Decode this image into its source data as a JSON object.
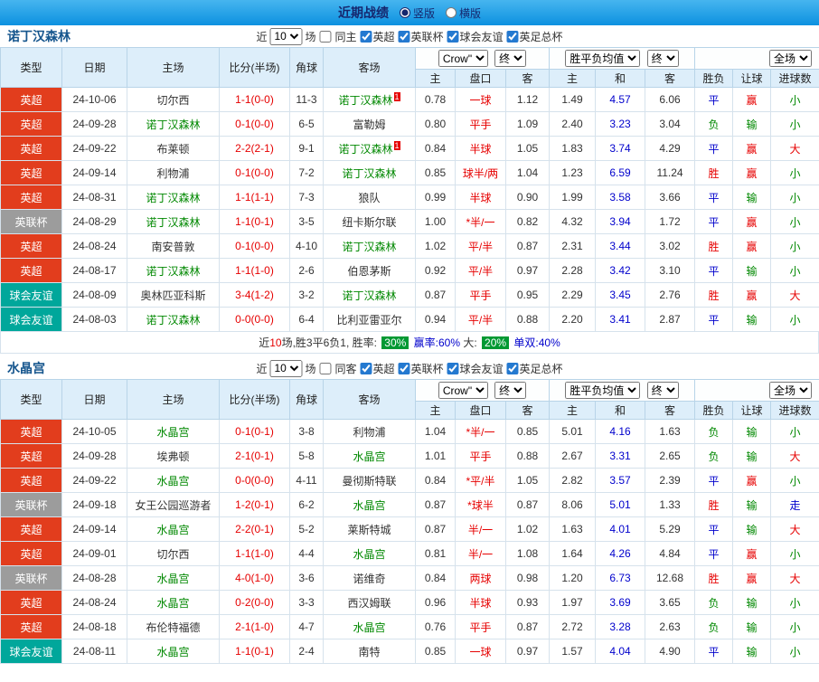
{
  "topbar": {
    "title": "近期战绩",
    "radios": [
      {
        "label": "竖版",
        "checked": true
      },
      {
        "label": "横版",
        "checked": false
      }
    ]
  },
  "colors": {
    "topbar_blue": "#0d91e0",
    "epl_red": "#e23d1d",
    "league_cup_gray": "#9c9c9c",
    "friendly_teal": "#00a79b",
    "focus_team_green": "#008800",
    "win_red": "#e60000",
    "loss_green": "#008800",
    "draw_blue": "#0000cc",
    "badge_green": "#009933"
  },
  "sections": [
    {
      "team": "诺丁汉森林",
      "filter": {
        "near": "近",
        "count": "10",
        "games": "场",
        "same": "同主",
        "same_checked": false,
        "leagues": [
          {
            "label": "英超",
            "checked": true
          },
          {
            "label": "英联杯",
            "checked": true
          },
          {
            "label": "球会友谊",
            "checked": true
          },
          {
            "label": "英足总杯",
            "checked": true
          }
        ]
      },
      "thead": {
        "type": "类型",
        "date": "日期",
        "home": "主场",
        "score": "比分(半场)",
        "corner": "角球",
        "away": "客场",
        "company": "Crow\"",
        "final1": "终",
        "avg": "胜平负均值",
        "final2": "终",
        "scope": "全场",
        "subs": [
          "主",
          "盘口",
          "客",
          "主",
          "和",
          "客",
          "胜负",
          "让球",
          "进球数"
        ]
      },
      "rows": [
        {
          "l": "英超",
          "lc": "lg-epl",
          "d": "24-10-06",
          "h": "切尔西",
          "hf": false,
          "hs": "",
          "s": "1-1(0-0)",
          "c": "11-3",
          "a": "诺丁汉森林",
          "af": true,
          "as": "1",
          "o1": "0.78",
          "hc": "一球",
          "o2": "1.12",
          "e1": "1.49",
          "e2": "4.57",
          "e3": "6.06",
          "r": "平",
          "rc": "t-blue",
          "lt": "赢",
          "ltc": "t-red",
          "g": "小",
          "gc": "t-green"
        },
        {
          "l": "英超",
          "lc": "lg-epl",
          "d": "24-09-28",
          "h": "诺丁汉森林",
          "hf": true,
          "hs": "",
          "s": "0-1(0-0)",
          "c": "6-5",
          "a": "富勒姆",
          "af": false,
          "as": "",
          "o1": "0.80",
          "hc": "平手",
          "o2": "1.09",
          "e1": "2.40",
          "e2": "3.23",
          "e3": "3.04",
          "r": "负",
          "rc": "t-green",
          "lt": "输",
          "ltc": "t-green",
          "g": "小",
          "gc": "t-green"
        },
        {
          "l": "英超",
          "lc": "lg-epl",
          "d": "24-09-22",
          "h": "布莱顿",
          "hf": false,
          "hs": "",
          "s": "2-2(2-1)",
          "c": "9-1",
          "a": "诺丁汉森林",
          "af": true,
          "as": "1",
          "o1": "0.84",
          "hc": "半球",
          "o2": "1.05",
          "e1": "1.83",
          "e2": "3.74",
          "e3": "4.29",
          "r": "平",
          "rc": "t-blue",
          "lt": "赢",
          "ltc": "t-red",
          "g": "大",
          "gc": "t-red"
        },
        {
          "l": "英超",
          "lc": "lg-epl",
          "d": "24-09-14",
          "h": "利物浦",
          "hf": false,
          "hs": "",
          "s": "0-1(0-0)",
          "c": "7-2",
          "a": "诺丁汉森林",
          "af": true,
          "as": "",
          "o1": "0.85",
          "hc": "球半/两",
          "o2": "1.04",
          "e1": "1.23",
          "e2": "6.59",
          "e3": "11.24",
          "r": "胜",
          "rc": "t-red",
          "lt": "赢",
          "ltc": "t-red",
          "g": "小",
          "gc": "t-green"
        },
        {
          "l": "英超",
          "lc": "lg-epl",
          "d": "24-08-31",
          "h": "诺丁汉森林",
          "hf": true,
          "hs": "",
          "s": "1-1(1-1)",
          "c": "7-3",
          "a": "狼队",
          "af": false,
          "as": "",
          "o1": "0.99",
          "hc": "半球",
          "o2": "0.90",
          "e1": "1.99",
          "e2": "3.58",
          "e3": "3.66",
          "r": "平",
          "rc": "t-blue",
          "lt": "输",
          "ltc": "t-green",
          "g": "小",
          "gc": "t-green"
        },
        {
          "l": "英联杯",
          "lc": "lg-lc",
          "d": "24-08-29",
          "h": "诺丁汉森林",
          "hf": true,
          "hs": "",
          "s": "1-1(0-1)",
          "c": "3-5",
          "a": "纽卡斯尔联",
          "af": false,
          "as": "",
          "o1": "1.00",
          "hc": "*半/一",
          "o2": "0.82",
          "e1": "4.32",
          "e2": "3.94",
          "e3": "1.72",
          "r": "平",
          "rc": "t-blue",
          "lt": "赢",
          "ltc": "t-red",
          "g": "小",
          "gc": "t-green"
        },
        {
          "l": "英超",
          "lc": "lg-epl",
          "d": "24-08-24",
          "h": "南安普敦",
          "hf": false,
          "hs": "",
          "s": "0-1(0-0)",
          "c": "4-10",
          "a": "诺丁汉森林",
          "af": true,
          "as": "",
          "o1": "1.02",
          "hc": "平/半",
          "o2": "0.87",
          "e1": "2.31",
          "e2": "3.44",
          "e3": "3.02",
          "r": "胜",
          "rc": "t-red",
          "lt": "赢",
          "ltc": "t-red",
          "g": "小",
          "gc": "t-green"
        },
        {
          "l": "英超",
          "lc": "lg-epl",
          "d": "24-08-17",
          "h": "诺丁汉森林",
          "hf": true,
          "hs": "",
          "s": "1-1(1-0)",
          "c": "2-6",
          "a": "伯恩茅斯",
          "af": false,
          "as": "",
          "o1": "0.92",
          "hc": "平/半",
          "o2": "0.97",
          "e1": "2.28",
          "e2": "3.42",
          "e3": "3.10",
          "r": "平",
          "rc": "t-blue",
          "lt": "输",
          "ltc": "t-green",
          "g": "小",
          "gc": "t-green"
        },
        {
          "l": "球会友谊",
          "lc": "lg-fr",
          "d": "24-08-09",
          "h": "奥林匹亚科斯",
          "hf": false,
          "hs": "",
          "s": "3-4(1-2)",
          "c": "3-2",
          "a": "诺丁汉森林",
          "af": true,
          "as": "",
          "o1": "0.87",
          "hc": "平手",
          "o2": "0.95",
          "e1": "2.29",
          "e2": "3.45",
          "e3": "2.76",
          "r": "胜",
          "rc": "t-red",
          "lt": "赢",
          "ltc": "t-red",
          "g": "大",
          "gc": "t-red"
        },
        {
          "l": "球会友谊",
          "lc": "lg-fr",
          "d": "24-08-03",
          "h": "诺丁汉森林",
          "hf": true,
          "hs": "",
          "s": "0-0(0-0)",
          "c": "6-4",
          "a": "比利亚雷亚尔",
          "af": false,
          "as": "",
          "o1": "0.94",
          "hc": "平/半",
          "o2": "0.88",
          "e1": "2.20",
          "e2": "3.41",
          "e3": "2.87",
          "r": "平",
          "rc": "t-blue",
          "lt": "输",
          "ltc": "t-green",
          "g": "小",
          "gc": "t-green"
        }
      ],
      "footer_parts": [
        {
          "text": "近",
          "cls": ""
        },
        {
          "text": "10",
          "cls": "t-red"
        },
        {
          "text": "场,胜3平6负1, 胜率: ",
          "cls": ""
        },
        {
          "text": "30%",
          "cls": "badge-green"
        },
        {
          "text": " 赢率:",
          "cls": "t-blue"
        },
        {
          "text": "60%",
          "cls": "t-blue"
        },
        {
          "text": " 大: ",
          "cls": ""
        },
        {
          "text": "20%",
          "cls": "badge-green"
        },
        {
          "text": " 单双:",
          "cls": "t-blue"
        },
        {
          "text": "40%",
          "cls": "t-blue"
        }
      ]
    },
    {
      "team": "水晶宫",
      "filter": {
        "near": "近",
        "count": "10",
        "games": "场",
        "same": "同客",
        "same_checked": false,
        "leagues": [
          {
            "label": "英超",
            "checked": true
          },
          {
            "label": "英联杯",
            "checked": true
          },
          {
            "label": "球会友谊",
            "checked": true
          },
          {
            "label": "英足总杯",
            "checked": true
          }
        ]
      },
      "thead": {
        "type": "类型",
        "date": "日期",
        "home": "主场",
        "score": "比分(半场)",
        "corner": "角球",
        "away": "客场",
        "company": "Crow\"",
        "final1": "终",
        "avg": "胜平负均值",
        "final2": "终",
        "scope": "全场",
        "subs": [
          "主",
          "盘口",
          "客",
          "主",
          "和",
          "客",
          "胜负",
          "让球",
          "进球数"
        ]
      },
      "rows": [
        {
          "l": "英超",
          "lc": "lg-epl",
          "d": "24-10-05",
          "h": "水晶宫",
          "hf": true,
          "hs": "",
          "s": "0-1(0-1)",
          "c": "3-8",
          "a": "利物浦",
          "af": false,
          "as": "",
          "o1": "1.04",
          "hc": "*半/一",
          "o2": "0.85",
          "e1": "5.01",
          "e2": "4.16",
          "e3": "1.63",
          "r": "负",
          "rc": "t-green",
          "lt": "输",
          "ltc": "t-green",
          "g": "小",
          "gc": "t-green"
        },
        {
          "l": "英超",
          "lc": "lg-epl",
          "d": "24-09-28",
          "h": "埃弗顿",
          "hf": false,
          "hs": "",
          "s": "2-1(0-1)",
          "c": "5-8",
          "a": "水晶宫",
          "af": true,
          "as": "",
          "o1": "1.01",
          "hc": "平手",
          "o2": "0.88",
          "e1": "2.67",
          "e2": "3.31",
          "e3": "2.65",
          "r": "负",
          "rc": "t-green",
          "lt": "输",
          "ltc": "t-green",
          "g": "大",
          "gc": "t-red"
        },
        {
          "l": "英超",
          "lc": "lg-epl",
          "d": "24-09-22",
          "h": "水晶宫",
          "hf": true,
          "hs": "",
          "s": "0-0(0-0)",
          "c": "4-11",
          "a": "曼彻斯特联",
          "af": false,
          "as": "",
          "o1": "0.84",
          "hc": "*平/半",
          "o2": "1.05",
          "e1": "2.82",
          "e2": "3.57",
          "e3": "2.39",
          "r": "平",
          "rc": "t-blue",
          "lt": "赢",
          "ltc": "t-red",
          "g": "小",
          "gc": "t-green"
        },
        {
          "l": "英联杯",
          "lc": "lg-lc",
          "d": "24-09-18",
          "h": "女王公园巡游者",
          "hf": false,
          "hs": "",
          "s": "1-2(0-1)",
          "c": "6-2",
          "a": "水晶宫",
          "af": true,
          "as": "",
          "o1": "0.87",
          "hc": "*球半",
          "o2": "0.87",
          "e1": "8.06",
          "e2": "5.01",
          "e3": "1.33",
          "r": "胜",
          "rc": "t-red",
          "lt": "输",
          "ltc": "t-green",
          "g": "走",
          "gc": "t-blue"
        },
        {
          "l": "英超",
          "lc": "lg-epl",
          "d": "24-09-14",
          "h": "水晶宫",
          "hf": true,
          "hs": "",
          "s": "2-2(0-1)",
          "c": "5-2",
          "a": "莱斯特城",
          "af": false,
          "as": "",
          "o1": "0.87",
          "hc": "半/一",
          "o2": "1.02",
          "e1": "1.63",
          "e2": "4.01",
          "e3": "5.29",
          "r": "平",
          "rc": "t-blue",
          "lt": "输",
          "ltc": "t-green",
          "g": "大",
          "gc": "t-red"
        },
        {
          "l": "英超",
          "lc": "lg-epl",
          "d": "24-09-01",
          "h": "切尔西",
          "hf": false,
          "hs": "",
          "s": "1-1(1-0)",
          "c": "4-4",
          "a": "水晶宫",
          "af": true,
          "as": "",
          "o1": "0.81",
          "hc": "半/一",
          "o2": "1.08",
          "e1": "1.64",
          "e2": "4.26",
          "e3": "4.84",
          "r": "平",
          "rc": "t-blue",
          "lt": "赢",
          "ltc": "t-red",
          "g": "小",
          "gc": "t-green"
        },
        {
          "l": "英联杯",
          "lc": "lg-lc",
          "d": "24-08-28",
          "h": "水晶宫",
          "hf": true,
          "hs": "",
          "s": "4-0(1-0)",
          "c": "3-6",
          "a": "诺维奇",
          "af": false,
          "as": "",
          "o1": "0.84",
          "hc": "两球",
          "o2": "0.98",
          "e1": "1.20",
          "e2": "6.73",
          "e3": "12.68",
          "r": "胜",
          "rc": "t-red",
          "lt": "赢",
          "ltc": "t-red",
          "g": "大",
          "gc": "t-red"
        },
        {
          "l": "英超",
          "lc": "lg-epl",
          "d": "24-08-24",
          "h": "水晶宫",
          "hf": true,
          "hs": "",
          "s": "0-2(0-0)",
          "c": "3-3",
          "a": "西汉姆联",
          "af": false,
          "as": "",
          "o1": "0.96",
          "hc": "半球",
          "o2": "0.93",
          "e1": "1.97",
          "e2": "3.69",
          "e3": "3.65",
          "r": "负",
          "rc": "t-green",
          "lt": "输",
          "ltc": "t-green",
          "g": "小",
          "gc": "t-green"
        },
        {
          "l": "英超",
          "lc": "lg-epl",
          "d": "24-08-18",
          "h": "布伦特福德",
          "hf": false,
          "hs": "",
          "s": "2-1(1-0)",
          "c": "4-7",
          "a": "水晶宫",
          "af": true,
          "as": "",
          "o1": "0.76",
          "hc": "平手",
          "o2": "0.87",
          "e1": "2.72",
          "e2": "3.28",
          "e3": "2.63",
          "r": "负",
          "rc": "t-green",
          "lt": "输",
          "ltc": "t-green",
          "g": "小",
          "gc": "t-green"
        },
        {
          "l": "球会友谊",
          "lc": "lg-fr",
          "d": "24-08-11",
          "h": "水晶宫",
          "hf": true,
          "hs": "",
          "s": "1-1(0-1)",
          "c": "2-4",
          "a": "南特",
          "af": false,
          "as": "",
          "o1": "0.85",
          "hc": "一球",
          "o2": "0.97",
          "e1": "1.57",
          "e2": "4.04",
          "e3": "4.90",
          "r": "平",
          "rc": "t-blue",
          "lt": "输",
          "ltc": "t-green",
          "g": "小",
          "gc": "t-green"
        }
      ]
    }
  ]
}
